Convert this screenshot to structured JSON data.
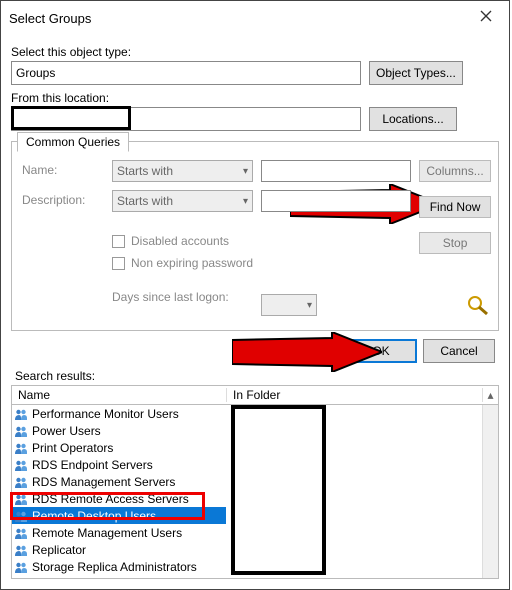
{
  "dialog": {
    "title": "Select Groups",
    "objectTypeLabel": "Select this object type:",
    "objectTypeValue": "Groups",
    "objectTypesBtn": "Object Types...",
    "locationLabel": "From this location:",
    "locationsBtn": "Locations...",
    "commonQueriesTab": "Common Queries",
    "query": {
      "nameLabel": "Name:",
      "descLabel": "Description:",
      "startsWith": "Starts with",
      "disabledAcc": "Disabled accounts",
      "nonExpPwd": "Non expiring password",
      "daysLastLogon": "Days since last logon:",
      "columnsBtn": "Columns...",
      "findNowBtn": "Find Now",
      "stopBtn": "Stop"
    },
    "okBtn": "OK",
    "cancelBtn": "Cancel",
    "searchResultsLabel": "Search results:",
    "columns": {
      "name": "Name",
      "inFolder": "In Folder"
    },
    "groups": [
      "Performance Monitor Users",
      "Power Users",
      "Print Operators",
      "RDS Endpoint Servers",
      "RDS Management Servers",
      "RDS Remote Access Servers",
      "Remote Desktop Users",
      "Remote Management Users",
      "Replicator",
      "Storage Replica Administrators"
    ],
    "selectedIndex": 6
  }
}
